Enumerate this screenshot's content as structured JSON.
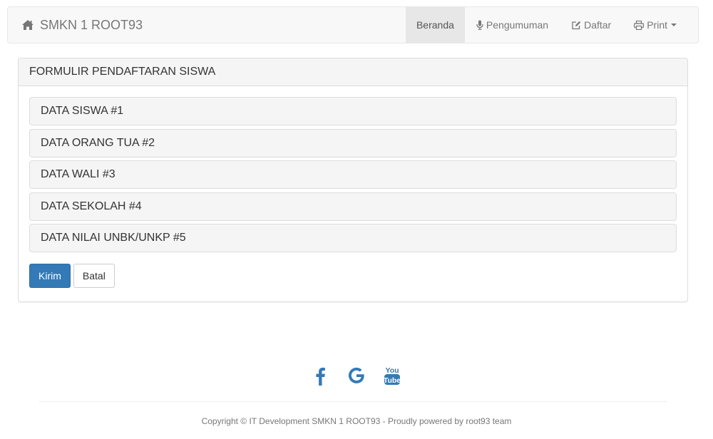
{
  "navbar": {
    "brand_label": "SMKN 1 ROOT93",
    "brand_icon": "home-icon",
    "items": [
      {
        "label": "Beranda",
        "icon": "",
        "active": true
      },
      {
        "label": "Pengumuman",
        "icon": "microphone-icon"
      },
      {
        "label": "Daftar",
        "icon": "edit-icon"
      },
      {
        "label": "Print",
        "icon": "print-icon",
        "dropdown": true
      }
    ]
  },
  "form": {
    "title": "FORMULIR PENDAFTARAN SISWA",
    "sections": [
      "DATA SISWA #1",
      "DATA ORANG TUA #2",
      "DATA WALI #3",
      "DATA SEKOLAH #4",
      "DATA NILAI UNBK/UNKP #5"
    ],
    "submit_label": "Kirim",
    "cancel_label": "Batal"
  },
  "footer": {
    "social_icons": [
      "facebook-icon",
      "google-icon",
      "youtube-icon"
    ],
    "copyright": "Copyright © IT Development SMKN 1 ROOT93 - Proudly powered by root93 team"
  },
  "colors": {
    "primary": "#337ab7",
    "social": "#337ab7",
    "navbar_bg": "#f8f8f8",
    "panel_heading_bg": "#f5f5f5"
  }
}
